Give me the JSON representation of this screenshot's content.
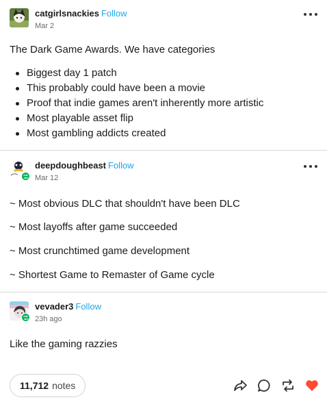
{
  "posts": [
    {
      "username": "catgirlsnackies",
      "follow_label": "Follow",
      "date": "Mar 2",
      "intro": "The Dark Game Awards. We have categories",
      "bullets": [
        "Biggest day 1 patch",
        "This probably could have been a movie",
        "Proof that indie games aren't inherently more artistic",
        "Most playable asset flip",
        "Most gambling addicts created"
      ]
    },
    {
      "username": "deepdoughbeast",
      "follow_label": "Follow",
      "date": "Mar 12",
      "lines": [
        "~ Most obvious DLC that shouldn't have been DLC",
        "~ Most layoffs after game succeeded",
        "~ Most crunchtimed game development",
        "~ Shortest Game to Remaster of Game cycle"
      ]
    },
    {
      "username": "vevader3",
      "follow_label": "Follow",
      "date": "23h ago",
      "body": "Like the gaming razzies"
    }
  ],
  "footer": {
    "notes_count": "11,712",
    "notes_label": "notes",
    "actions": [
      "share-icon",
      "reply-icon",
      "reblog-icon",
      "like-icon"
    ],
    "like_color": "#ff4930"
  },
  "colors": {
    "follow": "#1aa6e8",
    "reblog_badge": "#00b45a"
  }
}
